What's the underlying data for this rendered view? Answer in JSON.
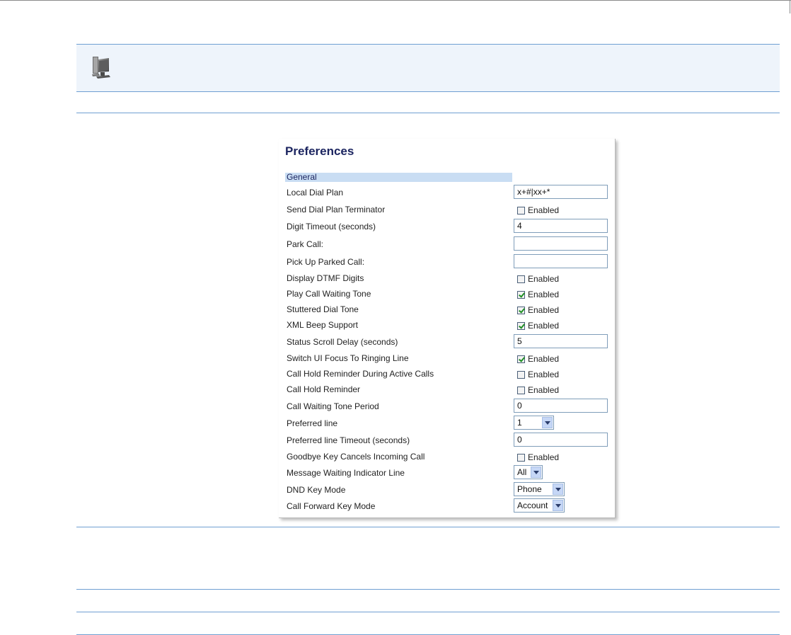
{
  "panel": {
    "title": "Preferences",
    "section": "General",
    "rows": [
      {
        "label": "Local Dial Plan",
        "type": "text",
        "value": "x+#|xx+*"
      },
      {
        "label": "Send Dial Plan Terminator",
        "type": "checkbox",
        "checked": false,
        "check_label": "Enabled"
      },
      {
        "label": "Digit Timeout (seconds)",
        "type": "text",
        "value": "4"
      },
      {
        "label": "Park Call:",
        "type": "text",
        "value": ""
      },
      {
        "label": "Pick Up Parked Call:",
        "type": "text",
        "value": ""
      },
      {
        "label": "Display DTMF Digits",
        "type": "checkbox",
        "checked": false,
        "check_label": "Enabled"
      },
      {
        "label": "Play Call Waiting Tone",
        "type": "checkbox",
        "checked": true,
        "check_label": "Enabled"
      },
      {
        "label": "Stuttered Dial Tone",
        "type": "checkbox",
        "checked": true,
        "check_label": "Enabled"
      },
      {
        "label": "XML Beep Support",
        "type": "checkbox",
        "checked": true,
        "check_label": "Enabled"
      },
      {
        "label": "Status Scroll Delay (seconds)",
        "type": "text",
        "value": "5"
      },
      {
        "label": "Switch UI Focus To Ringing Line",
        "type": "checkbox",
        "checked": true,
        "check_label": "Enabled"
      },
      {
        "label": "Call Hold Reminder During Active Calls",
        "type": "checkbox",
        "checked": false,
        "check_label": "Enabled"
      },
      {
        "label": "Call Hold Reminder",
        "type": "checkbox",
        "checked": false,
        "check_label": "Enabled"
      },
      {
        "label": "Call Waiting Tone Period",
        "type": "text",
        "value": "0"
      },
      {
        "label": "Preferred line",
        "type": "select",
        "value": "1"
      },
      {
        "label": "Preferred line Timeout (seconds)",
        "type": "text",
        "value": "0"
      },
      {
        "label": "Goodbye Key Cancels Incoming Call",
        "type": "checkbox",
        "checked": false,
        "check_label": "Enabled"
      },
      {
        "label": "Message Waiting Indicator Line",
        "type": "select",
        "value": "All"
      },
      {
        "label": "DND Key Mode",
        "type": "select",
        "value": "Phone"
      },
      {
        "label": "Call Forward Key Mode",
        "type": "select",
        "value": "Account"
      }
    ]
  },
  "icons": {
    "banner": "computer-monitor-icon"
  },
  "colors": {
    "rule": "#6f9fd2",
    "banner_bg": "#eef4fb",
    "section_bg": "#c9ddf3",
    "title": "#1c2560"
  }
}
